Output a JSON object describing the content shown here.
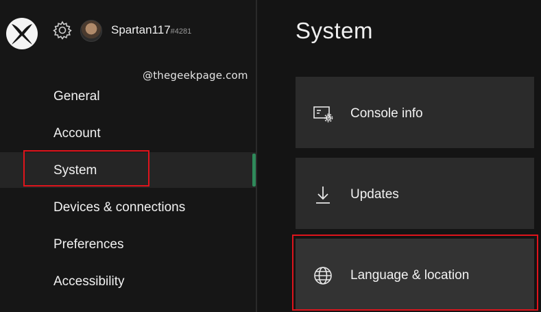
{
  "header": {
    "gamertag": "Spartan117",
    "gamertag_suffix": "#4281"
  },
  "watermark": "@thegeekpage.com",
  "sidebar": {
    "items": [
      {
        "label": "General"
      },
      {
        "label": "Account"
      },
      {
        "label": "System",
        "selected": true
      },
      {
        "label": "Devices & connections"
      },
      {
        "label": "Preferences"
      },
      {
        "label": "Accessibility"
      }
    ]
  },
  "main": {
    "title": "System",
    "tiles": [
      {
        "label": "Console info",
        "icon": "console-info-icon"
      },
      {
        "label": "Updates",
        "icon": "download-icon"
      },
      {
        "label": "Language & location",
        "icon": "globe-icon",
        "highlighted": true
      }
    ]
  },
  "colors": {
    "background": "#141414",
    "tile": "#2b2b2b",
    "focus_accent": "#2f8a5a",
    "annotation_red": "#e0141c"
  }
}
